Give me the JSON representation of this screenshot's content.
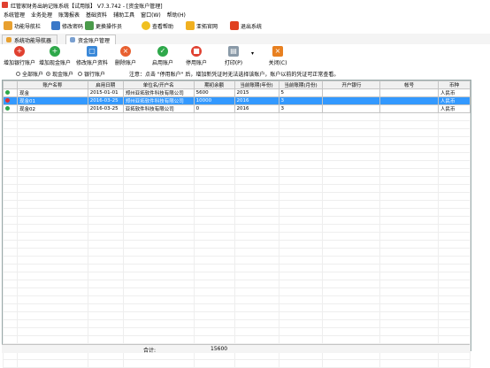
{
  "window": {
    "title": "红管家财务出纳记账系统【试用版】 V7.3.742 - [资金账户管理]"
  },
  "menubar": [
    "系统管理",
    "业务处理",
    "账簿报表",
    "基础资料",
    "辅助工具",
    "窗口(W)",
    "帮助(H)"
  ],
  "toolbar": {
    "nav": "功能导航栏",
    "change_password": "修改密码",
    "switch_operator": "更换操作员",
    "help": "查看帮助",
    "website": "亚拓官网",
    "exit": "退出系统"
  },
  "tabs": [
    "系统功能导航器",
    "资金账户管理"
  ],
  "actions": {
    "add_bank": "增加银行账户",
    "add_cash": "增加现金账户",
    "edit": "修改账户资料",
    "delete": "删除账户",
    "enable": "启用账户",
    "disable": "停用账户",
    "print": "打印(P)",
    "close": "关闭(C)"
  },
  "filter": {
    "all": "全部账户",
    "cash": "现金账户",
    "bank": "银行账户",
    "notice": "注意：点击 \"停用账户\" 后，增加新凭证时无法选择该账户，账户以前的凭证可正常查看。"
  },
  "table": {
    "columns": [
      "账户名称",
      "启用日期",
      "单位名/开户名",
      "期初余额",
      "当前账期(年份)",
      "当前账期(月份)",
      "开户银行",
      "帐号",
      "币种"
    ],
    "rows": [
      {
        "name": "现金",
        "date": "2015-01-01",
        "unit": "郑州亚拓软件科技有限公司",
        "balance": "5600",
        "year": "2015",
        "month": "5",
        "bank": "",
        "account": "",
        "currency": "人民币",
        "status_color": "#2ea84a",
        "selected": false
      },
      {
        "name": "现金01",
        "date": "2016-03-25",
        "unit": "郑州亚拓软件科技有限公司",
        "balance": "10000",
        "year": "2016",
        "month": "3",
        "bank": "",
        "account": "",
        "currency": "人民币",
        "status_color": "#e03030",
        "selected": true
      },
      {
        "name": "现金02",
        "date": "2016-03-25",
        "unit": "亚拓软件科技有限公司",
        "balance": "0",
        "year": "2016",
        "month": "3",
        "bank": "",
        "account": "",
        "currency": "人民币",
        "status_color": "#2ea84a",
        "selected": false
      }
    ],
    "total_label": "合计:",
    "total_value": "15600"
  }
}
